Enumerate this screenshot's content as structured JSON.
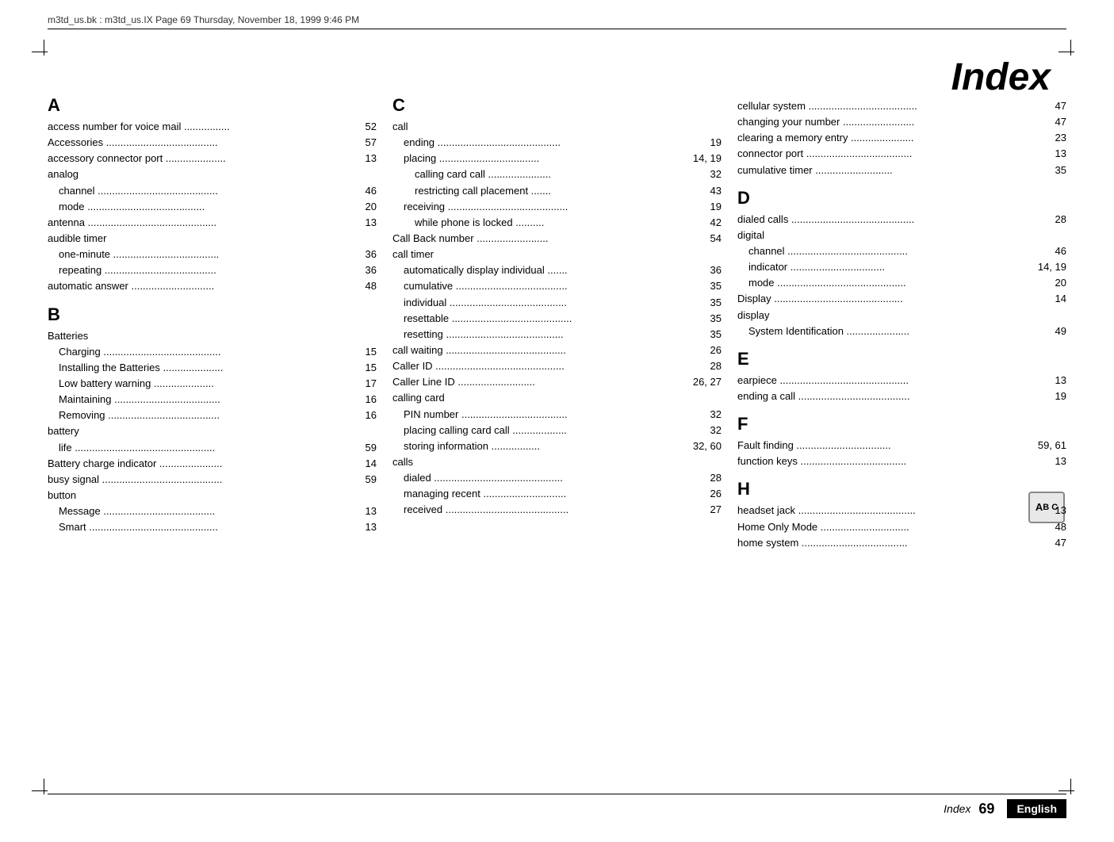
{
  "header": {
    "text": "m3td_us.bk : m3td_us.IX  Page 69  Thursday, November 18, 1999  9:46 PM"
  },
  "title": "Index",
  "footer": {
    "label": "Index",
    "page": "69",
    "language": "English"
  },
  "columns": [
    {
      "id": "col1",
      "sections": [
        {
          "letter": "A",
          "entries": [
            {
              "text": "access number for voice mail",
              "dots": "................",
              "page": "52",
              "indent": 0
            },
            {
              "text": "Accessories",
              "dots": ".......................................",
              "page": "57",
              "indent": 0
            },
            {
              "text": "accessory connector port",
              "dots": ".....................",
              "page": "13",
              "indent": 0
            },
            {
              "text": "analog",
              "dots": "",
              "page": "",
              "indent": 0
            },
            {
              "text": "channel",
              "dots": "..........................................",
              "page": "46",
              "indent": 1
            },
            {
              "text": "mode",
              "dots": ".........................................",
              "page": "20",
              "indent": 1
            },
            {
              "text": "antenna",
              "dots": ".............................................",
              "page": "13",
              "indent": 0
            },
            {
              "text": "audible timer",
              "dots": "",
              "page": "",
              "indent": 0
            },
            {
              "text": "one-minute",
              "dots": ".....................................",
              "page": "36",
              "indent": 1
            },
            {
              "text": "repeating",
              "dots": ".......................................",
              "page": "36",
              "indent": 1
            },
            {
              "text": "automatic answer",
              "dots": ".............................",
              "page": "48",
              "indent": 0
            }
          ]
        },
        {
          "letter": "B",
          "entries": [
            {
              "text": "Batteries",
              "dots": "",
              "page": "",
              "indent": 0
            },
            {
              "text": "Charging",
              "dots": ".........................................",
              "page": "15",
              "indent": 1
            },
            {
              "text": "Installing the Batteries",
              "dots": ".....................",
              "page": "15",
              "indent": 1
            },
            {
              "text": "Low battery warning",
              "dots": ".....................",
              "page": "17",
              "indent": 1
            },
            {
              "text": "Maintaining",
              "dots": ".....................................",
              "page": "16",
              "indent": 1
            },
            {
              "text": "Removing",
              "dots": ".......................................",
              "page": "16",
              "indent": 1
            },
            {
              "text": "battery",
              "dots": "",
              "page": "",
              "indent": 0
            },
            {
              "text": "life",
              "dots": ".................................................",
              "page": "59",
              "indent": 1
            },
            {
              "text": "Battery charge indicator",
              "dots": "......................",
              "page": "14",
              "indent": 0
            },
            {
              "text": "busy signal",
              "dots": "..........................................",
              "page": "59",
              "indent": 0
            },
            {
              "text": "button",
              "dots": "",
              "page": "",
              "indent": 0
            },
            {
              "text": "Message",
              "dots": ".......................................",
              "page": "13",
              "indent": 1
            },
            {
              "text": "Smart",
              "dots": ".............................................",
              "page": "13",
              "indent": 1
            }
          ]
        }
      ]
    },
    {
      "id": "col2",
      "sections": [
        {
          "letter": "C",
          "entries": [
            {
              "text": "call",
              "dots": "",
              "page": "",
              "indent": 0
            },
            {
              "text": "ending",
              "dots": "...........................................",
              "page": "19",
              "indent": 1
            },
            {
              "text": "placing",
              "dots": "...................................",
              "page": "14, 19",
              "indent": 1
            },
            {
              "text": "calling card call",
              "dots": "......................",
              "page": "32",
              "indent": 2
            },
            {
              "text": "restricting call placement",
              "dots": ".......",
              "page": "43",
              "indent": 2
            },
            {
              "text": "receiving",
              "dots": "..........................................",
              "page": "19",
              "indent": 1
            },
            {
              "text": "while phone is locked",
              "dots": "..........",
              "page": "42",
              "indent": 2
            },
            {
              "text": "Call Back number",
              "dots": ".........................",
              "page": "54",
              "indent": 0
            },
            {
              "text": "call timer",
              "dots": "",
              "page": "",
              "indent": 0
            },
            {
              "text": "automatically display individual",
              "dots": ".......",
              "page": "36",
              "indent": 1
            },
            {
              "text": "cumulative",
              "dots": ".......................................",
              "page": "35",
              "indent": 1
            },
            {
              "text": "individual",
              "dots": ".........................................",
              "page": "35",
              "indent": 1
            },
            {
              "text": "resettable",
              "dots": "..........................................",
              "page": "35",
              "indent": 1
            },
            {
              "text": "resetting",
              "dots": ".........................................",
              "page": "35",
              "indent": 1
            },
            {
              "text": "call waiting",
              "dots": "..........................................",
              "page": "26",
              "indent": 0
            },
            {
              "text": "Caller ID",
              "dots": ".............................................",
              "page": "28",
              "indent": 0
            },
            {
              "text": "Caller Line ID",
              "dots": "...........................",
              "page": "26, 27",
              "indent": 0
            },
            {
              "text": "calling card",
              "dots": "",
              "page": "",
              "indent": 0
            },
            {
              "text": "PIN number",
              "dots": ".....................................",
              "page": "32",
              "indent": 1
            },
            {
              "text": "placing calling card call",
              "dots": "...................",
              "page": "32",
              "indent": 1
            },
            {
              "text": "storing information",
              "dots": ".................",
              "page": "32, 60",
              "indent": 1
            },
            {
              "text": "calls",
              "dots": "",
              "page": "",
              "indent": 0
            },
            {
              "text": "dialed",
              "dots": ".............................................",
              "page": "28",
              "indent": 1
            },
            {
              "text": "managing recent",
              "dots": ".............................",
              "page": "26",
              "indent": 1
            },
            {
              "text": "received",
              "dots": "...........................................",
              "page": "27",
              "indent": 1
            }
          ]
        }
      ]
    },
    {
      "id": "col3",
      "sections": [
        {
          "letter": "",
          "entries": [
            {
              "text": "cellular system",
              "dots": "......................................",
              "page": "47",
              "indent": 0
            },
            {
              "text": "changing your number",
              "dots": ".........................",
              "page": "47",
              "indent": 0
            },
            {
              "text": "clearing a memory entry",
              "dots": "......................",
              "page": "23",
              "indent": 0
            },
            {
              "text": "connector port",
              "dots": ".....................................",
              "page": "13",
              "indent": 0
            },
            {
              "text": "cumulative timer",
              "dots": "...........................",
              "page": "35",
              "indent": 0
            }
          ]
        },
        {
          "letter": "D",
          "entries": [
            {
              "text": "dialed calls",
              "dots": "...........................................",
              "page": "28",
              "indent": 0
            },
            {
              "text": "digital",
              "dots": "",
              "page": "",
              "indent": 0
            },
            {
              "text": "channel",
              "dots": "..........................................",
              "page": "46",
              "indent": 1
            },
            {
              "text": "indicator",
              "dots": ".................................",
              "page": "14, 19",
              "indent": 1
            },
            {
              "text": "mode",
              "dots": ".............................................",
              "page": "20",
              "indent": 1
            },
            {
              "text": "Display",
              "dots": ".............................................",
              "page": "14",
              "indent": 0
            },
            {
              "text": "display",
              "dots": "",
              "page": "",
              "indent": 0
            },
            {
              "text": "System Identification",
              "dots": "......................",
              "page": "49",
              "indent": 1
            }
          ]
        },
        {
          "letter": "E",
          "entries": [
            {
              "text": "earpiece",
              "dots": ".............................................",
              "page": "13",
              "indent": 0
            },
            {
              "text": "ending a call",
              "dots": ".......................................",
              "page": "19",
              "indent": 0
            }
          ]
        },
        {
          "letter": "F",
          "entries": [
            {
              "text": "Fault finding",
              "dots": ".................................",
              "page": "59, 61",
              "indent": 0
            },
            {
              "text": "function keys",
              "dots": ".....................................",
              "page": "13",
              "indent": 0
            }
          ]
        },
        {
          "letter": "H",
          "entries": [
            {
              "text": "headset jack",
              "dots": ".........................................",
              "page": "13",
              "indent": 0
            },
            {
              "text": "Home Only Mode",
              "dots": "...............................",
              "page": "48",
              "indent": 0
            },
            {
              "text": "home system",
              "dots": ".....................................",
              "page": "47",
              "indent": 0
            }
          ]
        }
      ]
    }
  ]
}
